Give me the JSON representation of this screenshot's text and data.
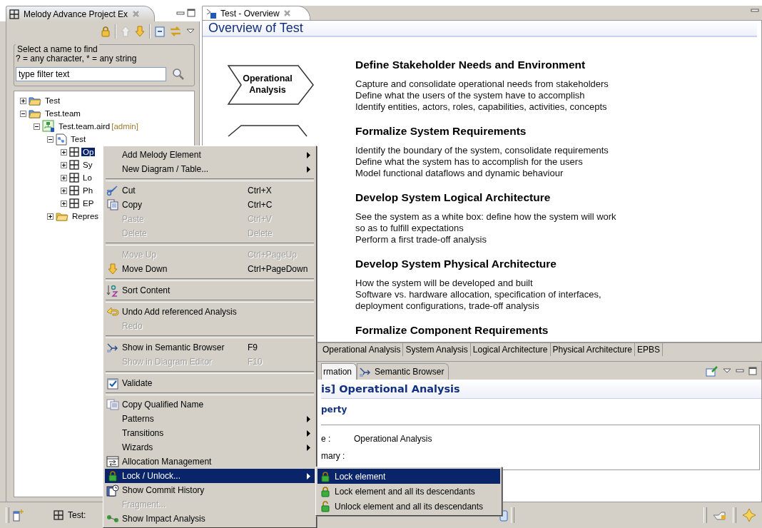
{
  "explorer": {
    "title": "Melody Advance Project Ex",
    "filter_group": "Select a name to find",
    "filter_hint": "? = any character, * = any string",
    "filter": {
      "placeholder": "type filter text"
    },
    "tree": [
      {
        "label": "Test",
        "kind": "project",
        "expanded": false,
        "selected": false
      },
      {
        "label": "Test.team",
        "kind": "project",
        "expanded": true,
        "selected": false,
        "children": [
          {
            "label": "Test.team.aird",
            "tag": "[admin]",
            "kind": "aird",
            "expanded": true,
            "selected": false,
            "children": [
              {
                "label": "Test",
                "kind": "model",
                "expanded": true,
                "selected": false,
                "children": [
                  {
                    "label": "Op",
                    "kind": "package",
                    "expanded": false,
                    "selected": true
                  },
                  {
                    "label": "Sy",
                    "kind": "package",
                    "expanded": false,
                    "selected": false
                  },
                  {
                    "label": "Lo",
                    "kind": "package",
                    "expanded": false,
                    "selected": false
                  },
                  {
                    "label": "Ph",
                    "kind": "package",
                    "expanded": false,
                    "selected": false
                  },
                  {
                    "label": "EP",
                    "kind": "package",
                    "expanded": false,
                    "selected": false
                  }
                ]
              },
              {
                "label": "Repres",
                "kind": "folder",
                "expanded": false,
                "selected": false
              }
            ]
          }
        ]
      }
    ]
  },
  "editor": {
    "tab": "Test - Overview",
    "title": "Overview of Test",
    "shape_label": "Operational Analysis",
    "sections": [
      {
        "heading": "Define Stakeholder Needs and Environment",
        "lines": [
          "Capture and consolidate operational needs from stakeholders",
          "Define what the users of the system have to accomplish",
          "Identify entities, actors, roles, capabilities, activities, concepts"
        ]
      },
      {
        "heading": "Formalize System Requirements",
        "lines": [
          "Identify the boundary of the system, consolidate requirements",
          "Define what the system has to accomplish for the users",
          "Model functional dataflows and dynamic behaviour"
        ]
      },
      {
        "heading": "Develop System Logical Architecture",
        "lines": [
          "See the system as a white box: define how the system will work",
          "so as to fulfill expectations",
          "Perform a first trade-off analysis"
        ]
      },
      {
        "heading": "Develop System Physical Architecture",
        "lines": [
          "How the system will be developed and built",
          "Software vs. hardware allocation, specification of interfaces,",
          "deployment configurations, trade-off analysis"
        ]
      },
      {
        "heading": "Formalize Component Requirements"
      }
    ],
    "page_tabs": [
      {
        "label": "Operational Analysis",
        "selected": false
      },
      {
        "label": "System Analysis",
        "selected": false
      },
      {
        "label": "Logical Architecture",
        "selected": false
      },
      {
        "label": "Physical Architecture",
        "selected": false
      },
      {
        "label": "EPBS",
        "selected": false
      }
    ]
  },
  "properties": {
    "tabs": [
      {
        "label": "rmation",
        "selected": true
      },
      {
        "label": "Semantic Browser",
        "selected": false
      }
    ],
    "title": "is] Operational Analysis",
    "section": "perty",
    "fields": [
      {
        "label": "e :",
        "value": "Operational Analysis"
      },
      {
        "label": "mary :"
      }
    ]
  },
  "status_bar": {
    "editor_label": "Test:"
  },
  "context_menu": {
    "items": [
      {
        "kind": "plain",
        "label": "Add Melody Element",
        "has_submenu": true,
        "disabled": false,
        "selected": false
      },
      {
        "kind": "plain",
        "label": "New Diagram / Table...",
        "has_submenu": true,
        "disabled": false,
        "selected": false
      },
      {
        "kind": "separator"
      },
      {
        "kind": "cut",
        "label": "Cut",
        "shortcut": "Ctrl+X",
        "disabled": false,
        "selected": false
      },
      {
        "kind": "copy",
        "label": "Copy",
        "shortcut": "Ctrl+C",
        "disabled": false,
        "selected": false
      },
      {
        "kind": "plain",
        "label": "Paste",
        "shortcut": "Ctrl+V",
        "disabled": true,
        "selected": false
      },
      {
        "kind": "plain",
        "label": "Delete",
        "shortcut": "Delete",
        "disabled": true,
        "selected": false
      },
      {
        "kind": "separator"
      },
      {
        "kind": "plain",
        "label": "Move Up",
        "shortcut": "Ctrl+PageUp",
        "disabled": true,
        "selected": false
      },
      {
        "kind": "move",
        "label": "Move Down",
        "shortcut": "Ctrl+PageDown",
        "disabled": false,
        "selected": false
      },
      {
        "kind": "separator"
      },
      {
        "kind": "sort",
        "label": "Sort Content",
        "disabled": false,
        "selected": false
      },
      {
        "kind": "separator"
      },
      {
        "kind": "undo",
        "label": "Undo Add referenced Analysis",
        "disabled": false,
        "selected": false
      },
      {
        "kind": "plain",
        "label": "Redo",
        "disabled": true,
        "selected": false
      },
      {
        "kind": "separator"
      },
      {
        "kind": "browse",
        "label": "Show in Semantic Browser",
        "shortcut": "F9",
        "disabled": false,
        "selected": false
      },
      {
        "kind": "plain",
        "label": "Show in Diagram Editor",
        "shortcut": "F10",
        "disabled": true,
        "selected": false
      },
      {
        "kind": "separator"
      },
      {
        "kind": "validate",
        "label": "Validate",
        "disabled": false,
        "selected": false
      },
      {
        "kind": "separator"
      },
      {
        "kind": "qualified",
        "label": "Copy Qualified Name",
        "disabled": false,
        "selected": false
      },
      {
        "kind": "plain",
        "label": "Patterns",
        "has_submenu": true,
        "disabled": false,
        "selected": false
      },
      {
        "kind": "plain",
        "label": "Transitions",
        "has_submenu": true,
        "disabled": false,
        "selected": false
      },
      {
        "kind": "plain",
        "label": "Wizards",
        "has_submenu": true,
        "disabled": false,
        "selected": false
      },
      {
        "kind": "allocation",
        "label": "Allocation Management",
        "disabled": false,
        "selected": false
      },
      {
        "kind": "lock",
        "label": "Lock / Unlock...",
        "has_submenu": true,
        "disabled": false,
        "selected": true,
        "submenu": [
          {
            "kind": "lock",
            "label": "Lock element",
            "selected": true
          },
          {
            "kind": "lock",
            "label": "Lock element and all its descendants",
            "selected": false
          },
          {
            "kind": "unlock",
            "label": "Unlock element and all its descendants",
            "selected": false
          }
        ]
      },
      {
        "kind": "history",
        "label": "Show Commit History",
        "disabled": false,
        "selected": false
      },
      {
        "kind": "plain",
        "label": "Fragment...",
        "disabled": true,
        "selected": false
      },
      {
        "kind": "impact",
        "label": "Show Impact Analysis",
        "disabled": false,
        "selected": false
      }
    ]
  }
}
